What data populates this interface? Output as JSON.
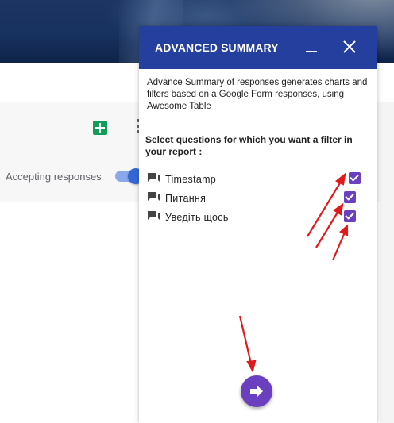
{
  "background": {
    "accepting_label": "Accepting responses"
  },
  "sidebar": {
    "title": "ADVANCED SUMMARY",
    "description": "Advance Summary of responses generates charts and filters based on a Google Form responses, using ",
    "description_link": "Awesome Table",
    "question": "Select questions for which you want a filter in your report :",
    "questions": [
      {
        "label": "Timestamp",
        "checked": true,
        "icon": "question-list-icon"
      },
      {
        "label": "Питання",
        "checked": true,
        "icon": "question-list-icon"
      },
      {
        "label": "Уведіть щось",
        "checked": true,
        "icon": "question-list-icon"
      }
    ],
    "next_icon": "arrow-right-icon"
  },
  "colors": {
    "header": "#253f9e",
    "accent": "#6a3fc0",
    "annotation_arrow": "#e0191b"
  }
}
